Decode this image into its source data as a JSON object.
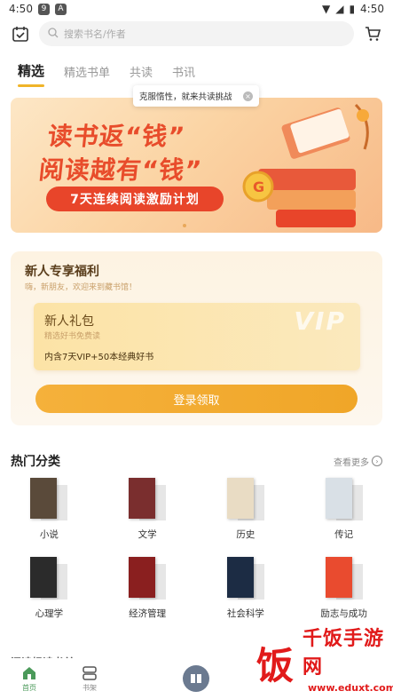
{
  "status_bar": {
    "time": "4:50",
    "badge1": "9",
    "badge2": "A"
  },
  "search": {
    "placeholder": "搜索书名/作者"
  },
  "tabs": [
    {
      "label": "精选",
      "active": true
    },
    {
      "label": "精选书单"
    },
    {
      "label": "共读"
    },
    {
      "label": "书讯"
    }
  ],
  "tooltip": {
    "text": "克服惰性，就来共读挑战"
  },
  "banner": {
    "line1": "读书返“钱”",
    "line2": "阅读越有“钱”",
    "pill": "7天连续阅读激励计划"
  },
  "new_user": {
    "title": "新人专享福利",
    "subtitle": "嗨，新朋友，欢迎来到藏书馆！",
    "gift_title": "新人礼包",
    "gift_subtitle": "精选好书免费读",
    "gift_desc": "内含7天VIP+50本经典好书",
    "vip_mark": "VIP",
    "login_button": "登录领取"
  },
  "hot": {
    "title": "热门分类",
    "more": "查看更多",
    "categories": [
      {
        "label": "小说",
        "color": "#5a4a3a"
      },
      {
        "label": "文学",
        "color": "#7a2e2e"
      },
      {
        "label": "历史",
        "color": "#e9dcc4"
      },
      {
        "label": "传记",
        "color": "#d9e0e6"
      },
      {
        "label": "心理学",
        "color": "#2b2b2b"
      },
      {
        "label": "经济管理",
        "color": "#8a1f1f"
      },
      {
        "label": "社会科学",
        "color": "#1c2c44"
      },
      {
        "label": "励志与成功",
        "color": "#e94b2f"
      }
    ]
  },
  "below_section": {
    "title": "阅读畅读书单"
  },
  "bottom_nav": {
    "home": "首页",
    "shelf": "书架"
  },
  "watermark": {
    "char": "饭",
    "text": "千饭手游网",
    "url": "www.eduxt.com"
  }
}
